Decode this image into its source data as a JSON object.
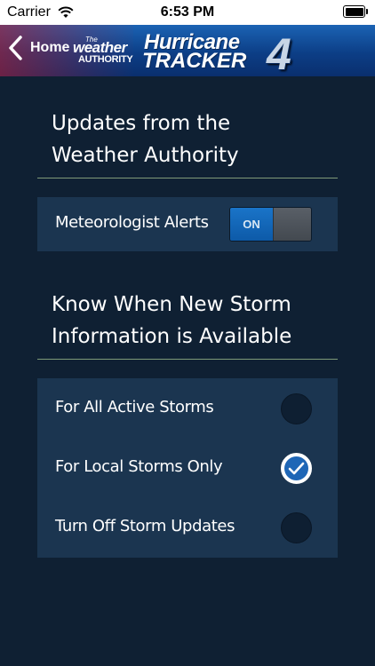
{
  "status_bar": {
    "carrier": "Carrier",
    "time": "6:53 PM"
  },
  "nav": {
    "back_label": "Home",
    "logo_the": "The",
    "logo_weather": "weather",
    "logo_authority": "AUTHORITY",
    "logo_hurricane": "Hurricane",
    "logo_tracker": "TRACKER",
    "logo_number": "4"
  },
  "section1": {
    "title_line1": "Updates from the",
    "title_line2": "Weather Authority",
    "alerts_label": "Meteorologist Alerts",
    "toggle_label": "ON",
    "toggle_state": "on"
  },
  "section2": {
    "title_line1": "Know When New Storm",
    "title_line2": "Information is Available",
    "options": [
      {
        "label": "For All Active Storms",
        "selected": false
      },
      {
        "label": "For Local Storms Only",
        "selected": true
      },
      {
        "label": "Turn Off Storm Updates",
        "selected": false
      }
    ]
  },
  "colors": {
    "background": "#0f2033",
    "card": "#1b3550",
    "accent": "#1e66b6",
    "divider": "#7f9a78"
  }
}
